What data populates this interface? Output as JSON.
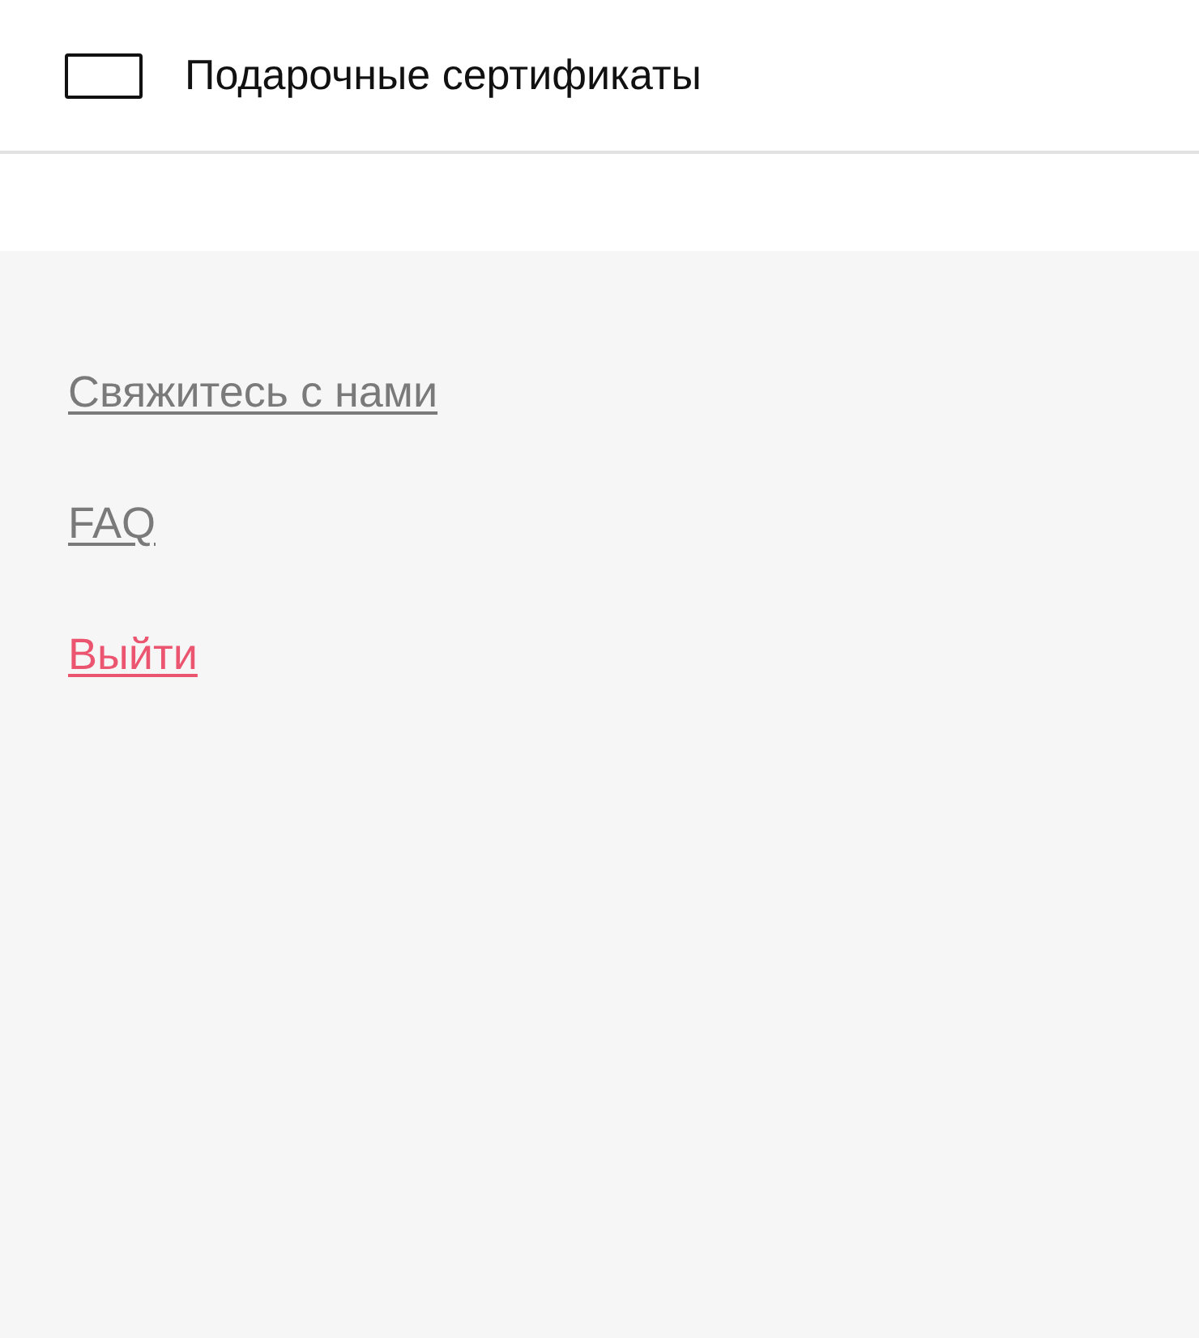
{
  "menu_items": [
    {
      "label": "Подарочные сертификаты"
    }
  ],
  "footer_links": [
    {
      "label": "Свяжитесь с нами",
      "kind": "normal"
    },
    {
      "label": "FAQ",
      "kind": "normal"
    },
    {
      "label": "Выйти",
      "kind": "logout"
    }
  ]
}
